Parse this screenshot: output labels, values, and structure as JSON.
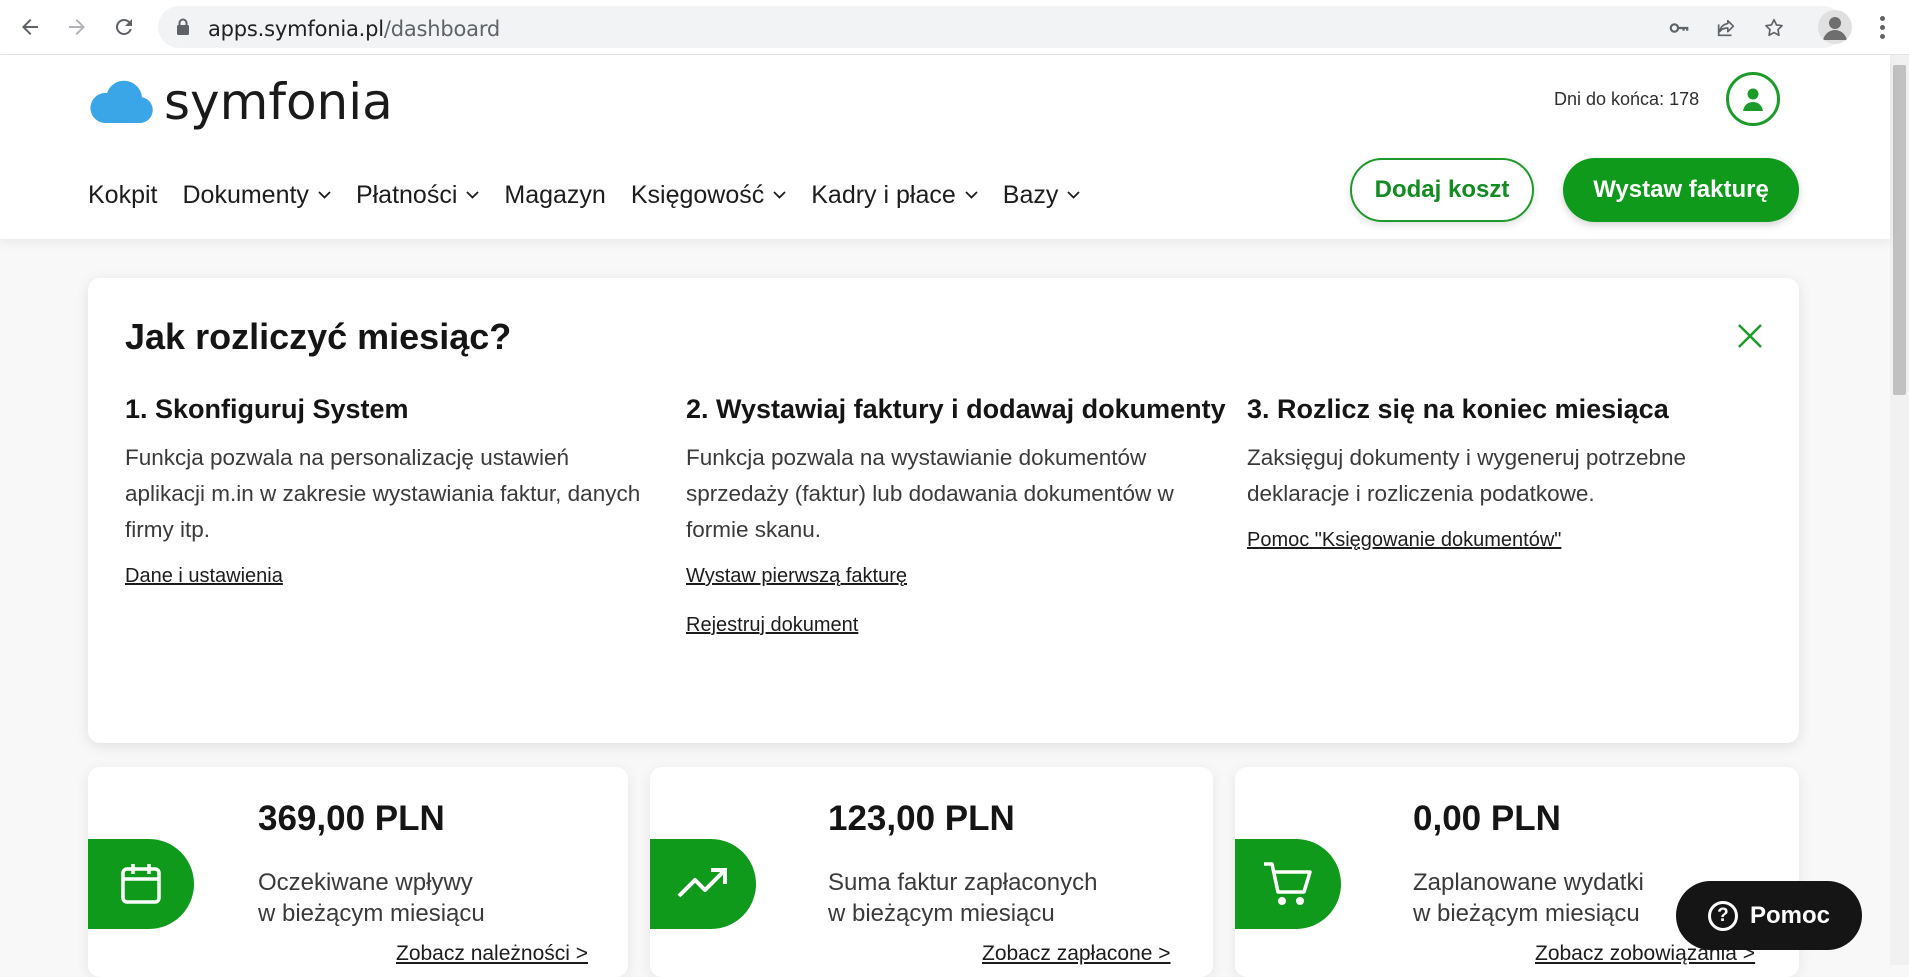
{
  "browser": {
    "url_domain": "apps.symfonia.pl",
    "url_path": "/dashboard"
  },
  "header": {
    "logo_text": "symfonia",
    "days_left": "Dni do końca: 178",
    "nav": [
      {
        "label": "Kokpit",
        "has_dropdown": false
      },
      {
        "label": "Dokumenty",
        "has_dropdown": true
      },
      {
        "label": "Płatności",
        "has_dropdown": true
      },
      {
        "label": "Magazyn",
        "has_dropdown": false
      },
      {
        "label": "Księgowość",
        "has_dropdown": true
      },
      {
        "label": "Kadry i płace",
        "has_dropdown": true
      },
      {
        "label": "Bazy",
        "has_dropdown": true
      }
    ],
    "add_cost_label": "Dodaj koszt",
    "issue_invoice_label": "Wystaw fakturę"
  },
  "guide": {
    "title": "Jak rozliczyć miesiąc?",
    "steps": [
      {
        "title": "1. Skonfiguruj System",
        "text": "Funkcja pozwala na personalizację ustawień aplikacji m.in w zakresie wystawiania faktur, danych firmy itp.",
        "links": [
          "Dane i ustawienia"
        ]
      },
      {
        "title": "2. Wystawiaj faktury i dodawaj dokumenty",
        "text": "Funkcja pozwala na wystawianie dokumentów sprzedaży (faktur) lub dodawania dokumentów w formie skanu.",
        "links": [
          "Wystaw pierwszą fakturę",
          "Rejestruj dokument"
        ]
      },
      {
        "title": "3. Rozlicz się na koniec miesiąca",
        "text": "Zaksięguj dokumenty i wygeneruj potrzebne deklaracje i rozliczenia podatkowe.",
        "links": [
          "Pomoc \"Księgowanie dokumentów\""
        ]
      }
    ]
  },
  "stats": [
    {
      "amount": "369,00 PLN",
      "label_line1": "Oczekiwane wpływy",
      "label_line2": "w bieżącym miesiącu",
      "link": "Zobacz należności >",
      "icon": "calendar-icon"
    },
    {
      "amount": "123,00 PLN",
      "label_line1": "Suma faktur zapłaconych",
      "label_line2": "w bieżącym miesiącu",
      "link": "Zobacz zapłacone >",
      "icon": "trend-up-icon"
    },
    {
      "amount": "0,00 PLN",
      "label_line1": "Zaplanowane wydatki",
      "label_line2": "w bieżącym miesiącu",
      "link": "Zobacz zobowiązania >",
      "icon": "cart-icon"
    }
  ],
  "help_label": "Pomoc",
  "colors": {
    "brand_green": "#0f9a1c",
    "logo_blue": "#3aa6e8",
    "text_dark": "#151515",
    "help_dark": "#151515"
  }
}
